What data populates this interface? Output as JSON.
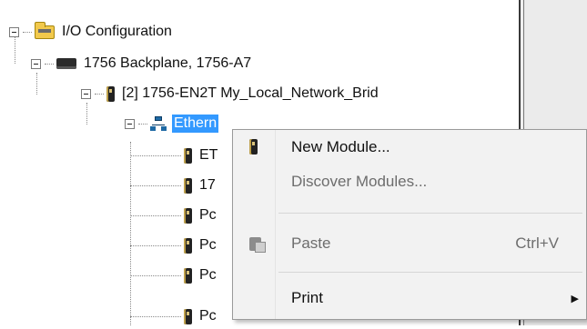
{
  "tree": {
    "root": {
      "label": "I/O Configuration",
      "icon": "folder-icon"
    },
    "backplane": {
      "label": "1756 Backplane, 1756-A7",
      "icon": "backplane-icon"
    },
    "bridge": {
      "label": "[2] 1756-EN2T My_Local_Network_Brid",
      "icon": "module-icon"
    },
    "network": {
      "label": "Ethernet",
      "visible_label": "Ethern",
      "selected": true,
      "icon": "network-icon"
    },
    "children": [
      {
        "label": "ET",
        "icon": "module-icon"
      },
      {
        "label": "17",
        "icon": "module-icon"
      },
      {
        "label": "Pc",
        "icon": "module-icon"
      },
      {
        "label": "Pc",
        "icon": "module-icon"
      },
      {
        "label": "Pc",
        "icon": "module-icon"
      },
      {
        "label": "Pc",
        "icon": "module-icon"
      }
    ]
  },
  "context_menu": {
    "items": [
      {
        "label": "New Module...",
        "enabled": true,
        "icon": "module-icon"
      },
      {
        "label": "Discover Modules...",
        "enabled": false
      },
      {
        "label": "Paste",
        "shortcut": "Ctrl+V",
        "enabled": false,
        "icon": "paste-icon"
      },
      {
        "label": "Print",
        "enabled": true,
        "submenu_arrow": "▶"
      }
    ]
  },
  "colors": {
    "selection": "#3399ff",
    "menu_bg": "#f2f2f2",
    "disabled_text": "#6d6d6d"
  }
}
